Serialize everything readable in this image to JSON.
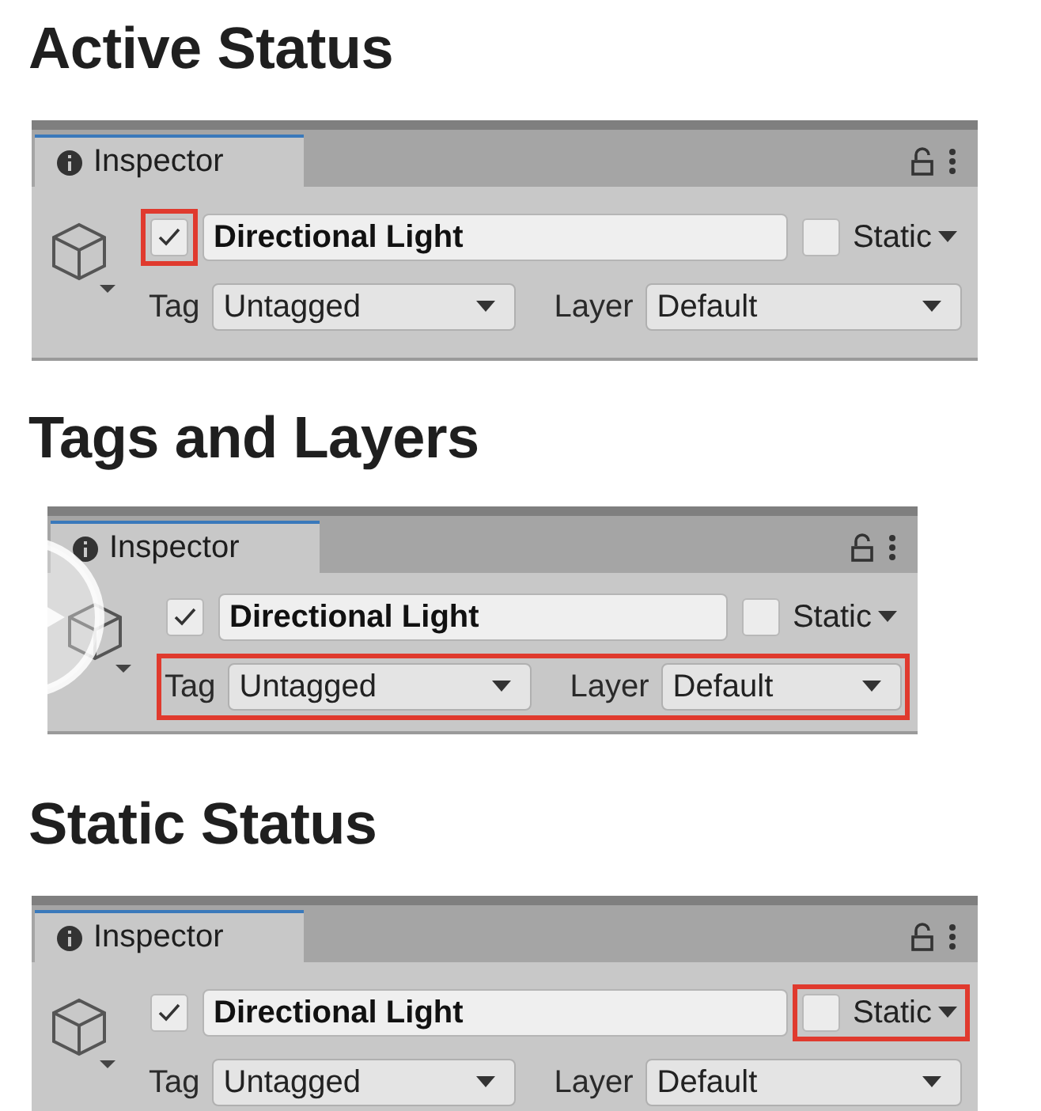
{
  "sections": [
    {
      "heading": "Active Status",
      "highlight": {
        "active_toggle": true,
        "tag_layer": false,
        "static_toggle": false
      },
      "inspector": {
        "tab": "Inspector",
        "active": true,
        "name": "Directional Light",
        "static": false,
        "static_label": "Static",
        "tag_label": "Tag",
        "tag": "Untagged",
        "layer_label": "Layer",
        "layer": "Default"
      }
    },
    {
      "heading": "Tags and Layers",
      "highlight": {
        "active_toggle": false,
        "tag_layer": true,
        "static_toggle": false
      },
      "inspector": {
        "tab": "Inspector",
        "active": true,
        "name": "Directional Light",
        "static": false,
        "static_label": "Static",
        "tag_label": "Tag",
        "tag": "Untagged",
        "layer_label": "Layer",
        "layer": "Default"
      }
    },
    {
      "heading": "Static Status",
      "highlight": {
        "active_toggle": false,
        "tag_layer": false,
        "static_toggle": true
      },
      "inspector": {
        "tab": "Inspector",
        "active": true,
        "name": "Directional Light",
        "static": false,
        "static_label": "Static",
        "tag_label": "Tag",
        "tag": "Untagged",
        "layer_label": "Layer",
        "layer": "Default"
      }
    }
  ]
}
